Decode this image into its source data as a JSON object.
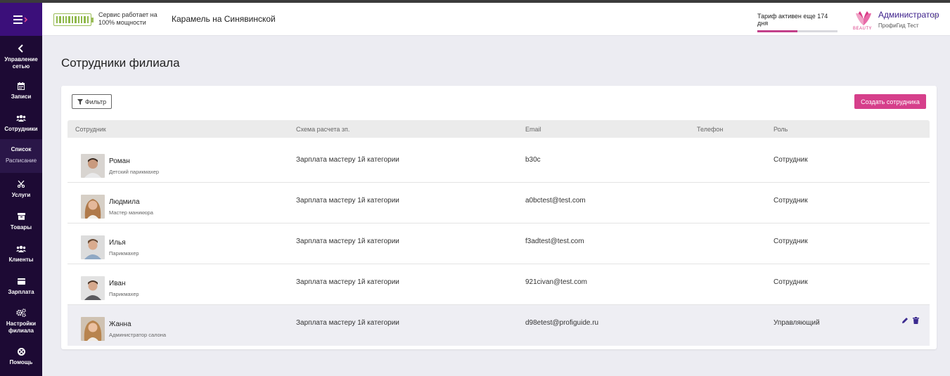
{
  "colors": {
    "sidebar_bg": "#1d0a34",
    "burger_bg": "#3b0f7a",
    "accent": "#d63f8b",
    "admin_name": "#3b1e8a",
    "action_icons": "#3b2a8f",
    "battery": "#8fb84a"
  },
  "sidebar": {
    "back": {
      "icon": "chevron-left-icon",
      "label": "Управление сетью"
    },
    "items_top": [
      {
        "icon": "calendar-icon",
        "label": "Записи"
      },
      {
        "icon": "users-icon",
        "label": "Сотрудники"
      }
    ],
    "sub": {
      "active": "Список",
      "other": "Расписание"
    },
    "items_bottom": [
      {
        "icon": "scissors-icon",
        "label": "Услуги"
      },
      {
        "icon": "box-icon",
        "label": "Товары"
      },
      {
        "icon": "clients-icon",
        "label": "Клиенты"
      },
      {
        "icon": "wallet-icon",
        "label": "Зарплата"
      },
      {
        "icon": "gears-icon",
        "label": "Настройки филиала"
      },
      {
        "icon": "help-icon",
        "label": "Помощь"
      }
    ]
  },
  "header": {
    "service_line1": "Сервис работает на",
    "service_line2": "100% мощности",
    "branch": "Карамель на Синявинской",
    "tariff": "Тариф активен еще 174 дня",
    "tariff_progress": 0.5,
    "logo_text": "BEAUTY",
    "admin_name": "Администратор",
    "admin_company": "ПрофиГид Тест"
  },
  "page": {
    "title": "Сотрудники филиала"
  },
  "toolbar": {
    "filter": "Фильтр",
    "create": "Создать сотрудника"
  },
  "table": {
    "headers": {
      "employee": "Сотрудник",
      "scheme": "Схема расчета зп.",
      "email": "Email",
      "phone": "Телефон",
      "role": "Роль"
    },
    "rows": [
      {
        "name": "Роман",
        "position": "Детский парикмахер",
        "scheme": "Зарплата мастеру 1й категории",
        "email": "b30c",
        "role": "Сотрудник"
      },
      {
        "name": "Людмила",
        "position": "Мастер маникюра",
        "scheme": "Зарплата мастеру 1й категории",
        "email": "a0bctest@test.com",
        "role": "Сотрудник"
      },
      {
        "name": "Илья",
        "position": "Парикмахер",
        "scheme": "Зарплата мастеру 1й категории",
        "email": "f3adtest@test.com",
        "role": "Сотрудник"
      },
      {
        "name": "Иван",
        "position": "Парикмахер",
        "scheme": "Зарплата мастеру 1й категории",
        "email": "921civan@test.com",
        "role": "Сотрудник"
      },
      {
        "name": "Жанна",
        "position": "Администратор салона",
        "scheme": "Зарплата мастеру 1й категории",
        "email": "d98etest@profiguide.ru",
        "role": "Управляющий"
      }
    ]
  }
}
